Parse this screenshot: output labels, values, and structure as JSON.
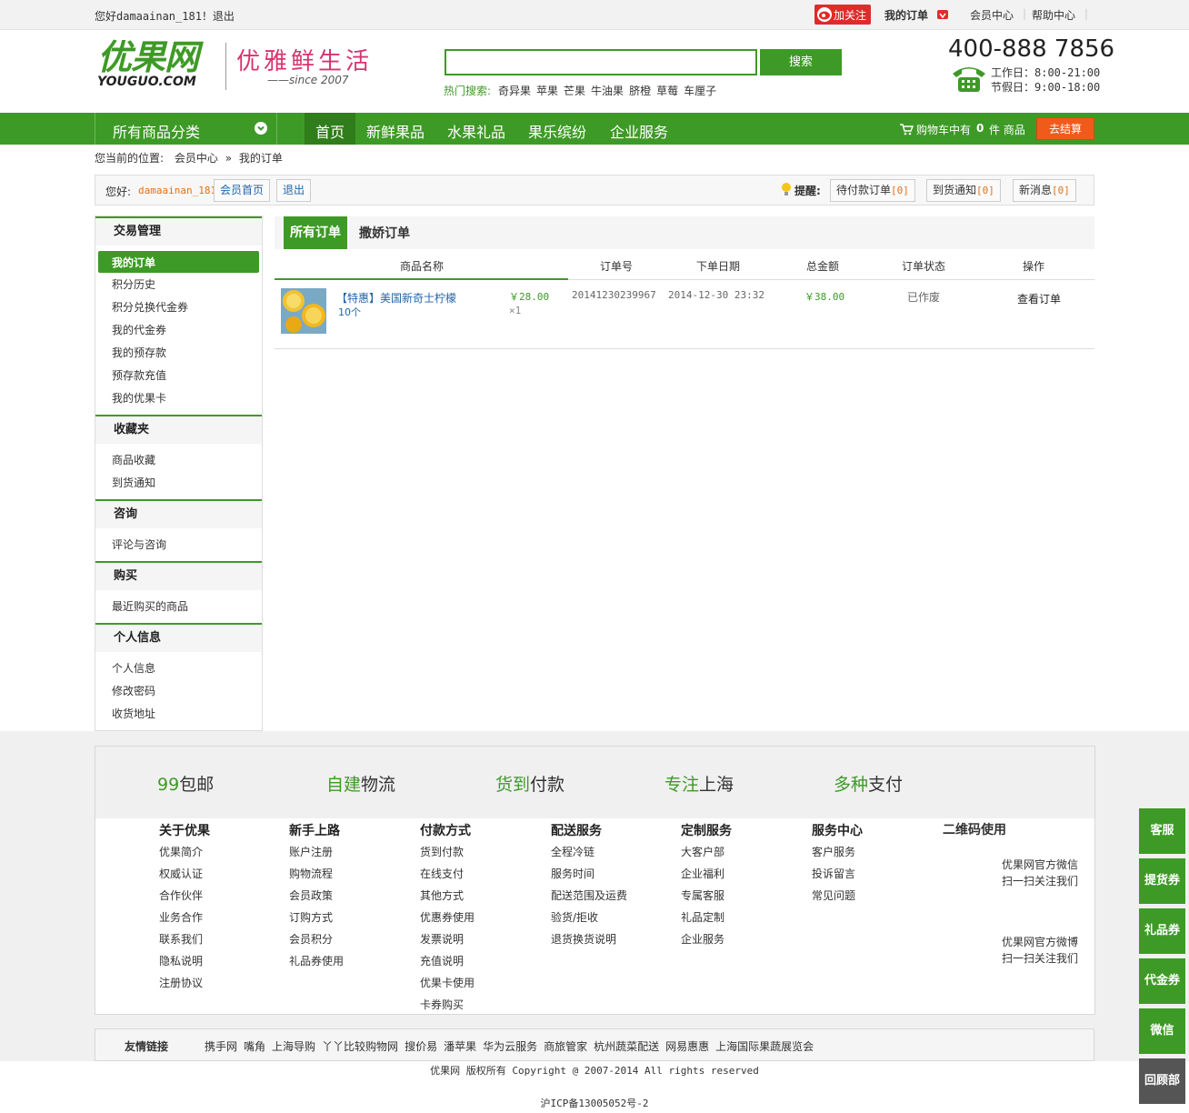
{
  "topbar": {
    "greeting": "您好damaainan_181！退出",
    "follow": "加关注",
    "my_orders": "我的订单",
    "member_center": "会员中心",
    "help_center": "帮助中心"
  },
  "header": {
    "logo_cn": "优果网",
    "logo_en": "YOUGUO.COM",
    "slogan": "优雅鲜生活",
    "since": "——since 2007",
    "search_button": "搜索",
    "search_value": "",
    "hot_label": "热门搜索:",
    "hot_terms": [
      "奇异果",
      "苹果",
      "芒果",
      "牛油果",
      "脐橙",
      "草莓",
      "车厘子"
    ],
    "phone": "400-888 7856",
    "workday": "工作日：8:00-21:00",
    "holiday": "节假日：9:00-18:00"
  },
  "nav": {
    "all_categories": "所有商品分类",
    "items": [
      "首页",
      "新鲜果品",
      "水果礼品",
      "果乐缤纷",
      "企业服务"
    ],
    "cart_prefix": "购物车中有",
    "cart_count": "0",
    "cart_suffix": "件 商品",
    "checkout": "去结算"
  },
  "breadcrumb": {
    "prefix": "您当前的位置:",
    "level1": "会员中心",
    "sep": "»",
    "level2": "我的订单"
  },
  "userbar": {
    "hello": "您好:",
    "username": "damaainan_181",
    "home_btn": "会员首页",
    "logout_btn": "退出",
    "remind_label": "提醒:",
    "pending_pay": "待付款订单",
    "pending_pay_count": "[0]",
    "arrival": "到货通知",
    "arrival_count": "[0]",
    "messages": "新消息",
    "messages_count": "[0]"
  },
  "sidebar": {
    "sections": [
      {
        "title": "交易管理",
        "items": [
          "我的订单",
          "积分历史",
          "积分兑换代金券",
          "我的代金券",
          "我的预存款",
          "预存款充值",
          "我的优果卡"
        ]
      },
      {
        "title": "收藏夹",
        "items": [
          "商品收藏",
          "到货通知"
        ]
      },
      {
        "title": "咨询",
        "items": [
          "评论与咨询"
        ]
      },
      {
        "title": "购买",
        "items": [
          "最近购买的商品"
        ]
      },
      {
        "title": "个人信息",
        "items": [
          "个人信息",
          "修改密码",
          "收货地址"
        ]
      }
    ]
  },
  "orders": {
    "tabs": [
      "所有订单",
      "撒娇订单"
    ],
    "columns": [
      "商品名称",
      "订单号",
      "下单日期",
      "总金额",
      "订单状态",
      "操作"
    ],
    "rows": [
      {
        "product": "【特惠】美国新奇士柠檬",
        "spec": "10个",
        "unit_price": "￥28.00",
        "qty": "×1",
        "order_no": "20141230239967",
        "date": "2014-12-30 23:32",
        "total": "￥38.00",
        "status": "已作废",
        "action": "查看订单"
      }
    ]
  },
  "features": [
    {
      "g": "99",
      "t": "包邮"
    },
    {
      "g": "自建",
      "t": "物流"
    },
    {
      "g": "货到",
      "t": "付款"
    },
    {
      "g": "专注",
      "t": "上海"
    },
    {
      "g": "多种",
      "t": "支付"
    }
  ],
  "footer_cols": [
    {
      "title": "关于优果",
      "items": [
        "优果简介",
        "权威认证",
        "合作伙伴",
        "业务合作",
        "联系我们",
        "隐私说明",
        "注册协议"
      ]
    },
    {
      "title": "新手上路",
      "items": [
        "账户注册",
        "购物流程",
        "会员政策",
        "订购方式",
        "会员积分",
        "礼品券使用"
      ]
    },
    {
      "title": "付款方式",
      "items": [
        "货到付款",
        "在线支付",
        "其他方式",
        "优惠券使用",
        "发票说明",
        "充值说明",
        "优果卡使用",
        "卡券购买"
      ]
    },
    {
      "title": "配送服务",
      "items": [
        "全程冷链",
        "服务时间",
        "配送范围及运费",
        "验货/拒收",
        "退货换货说明"
      ]
    },
    {
      "title": "定制服务",
      "items": [
        "大客户部",
        "企业福利",
        "专属客服",
        "礼品定制",
        "企业服务"
      ]
    },
    {
      "title": "服务中心",
      "items": [
        "客户服务",
        "投诉留言",
        "常见问题"
      ]
    }
  ],
  "qr": {
    "title": "二维码使用",
    "wechat1": "优果网官方微信",
    "wechat2": "扫一扫关注我们",
    "weibo1": "优果网官方微博",
    "weibo2": "扫一扫关注我们"
  },
  "friend_links": {
    "label": "友情链接",
    "items": [
      "携手网",
      "嘴角",
      "上海导购",
      "丫丫比较购物网",
      "搜价易",
      "潘苹果",
      "华为云服务",
      "商旅管家",
      "杭州蔬菜配送",
      "网易惠惠",
      "上海国际果蔬展览会"
    ]
  },
  "copyright": "优果网 版权所有 Copyright @ 2007-2014 All rights reserved",
  "icp": "沪ICP备13005052号-2",
  "right_float": [
    "客服",
    "提货券",
    "礼品券",
    "代金券",
    "微信",
    "回顾部"
  ],
  "colors": {
    "brand_green": "#3e9a26",
    "orange": "#f05a1a",
    "price": "#3e9a26"
  }
}
